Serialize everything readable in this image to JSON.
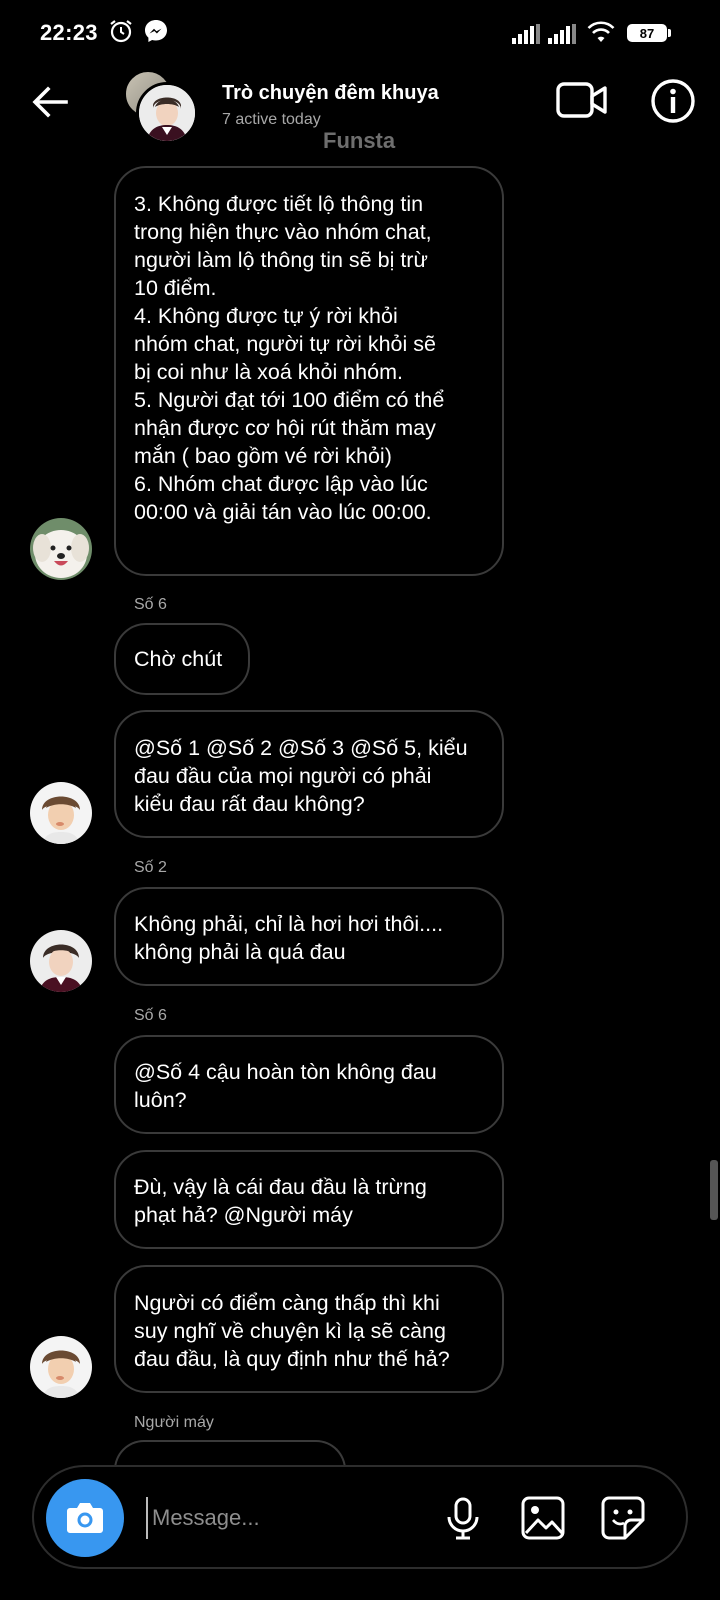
{
  "status_bar": {
    "time": "22:23",
    "battery": "87"
  },
  "header": {
    "title": "Trò chuyện đêm khuya",
    "subtitle": "7 active today",
    "watermark": "Funsta"
  },
  "messages": [
    {
      "text": "3. Không được tiết lộ thông tin\ntrong hiện thực vào nhóm chat,\nngười làm lộ thông tin sẽ bị trừ\n10 điểm.\n4. Không được tự ý rời khỏi\nnhóm chat, người tự rời khỏi sẽ\nbị coi như là xoá khỏi nhóm.\n5. Người đạt tới 100 điểm có thể\nnhận được cơ hội rút thăm may\nmắn ( bao gồm vé rời khỏi)\n6. Nhóm chat được lập vào lúc\n00:00 và giải tán vào lúc 00:00."
    },
    {
      "sender": "Số 6",
      "text": "Chờ chút"
    },
    {
      "text": "@Số 1 @Số 2 @Số 3 @Số 5, kiểu\nđau đầu của mọi người có phải\nkiểu đau rất đau không?"
    },
    {
      "sender": "Số 2",
      "text": "Không phải, chỉ là hơi hơi thôi....\nkhông phải là quá đau"
    },
    {
      "sender": "Số 6",
      "text": "@Số 4 cậu hoàn tòn không đau\nluôn?"
    },
    {
      "text": "Đù, vậy là cái đau đầu là trừng\nphạt hả? @Người máy"
    },
    {
      "text": "Người có điểm càng thấp thì khi\nsuy nghĩ về chuyện kì lạ sẽ càng\nđau đầu, là quy định như thế hả?"
    },
    {
      "sender": "Người máy"
    }
  ],
  "composer": {
    "placeholder": "Message..."
  },
  "icons": {
    "back": "arrow-left-icon",
    "video": "video-camera-icon",
    "info": "info-icon",
    "camera": "camera-icon",
    "mic": "microphone-icon",
    "gallery": "image-icon",
    "sticker": "sticker-icon"
  },
  "colors": {
    "background": "#000000",
    "bubble_border": "#3a3a3a",
    "camera_button": "#3897f0",
    "secondary_text": "#a8a8a8"
  }
}
